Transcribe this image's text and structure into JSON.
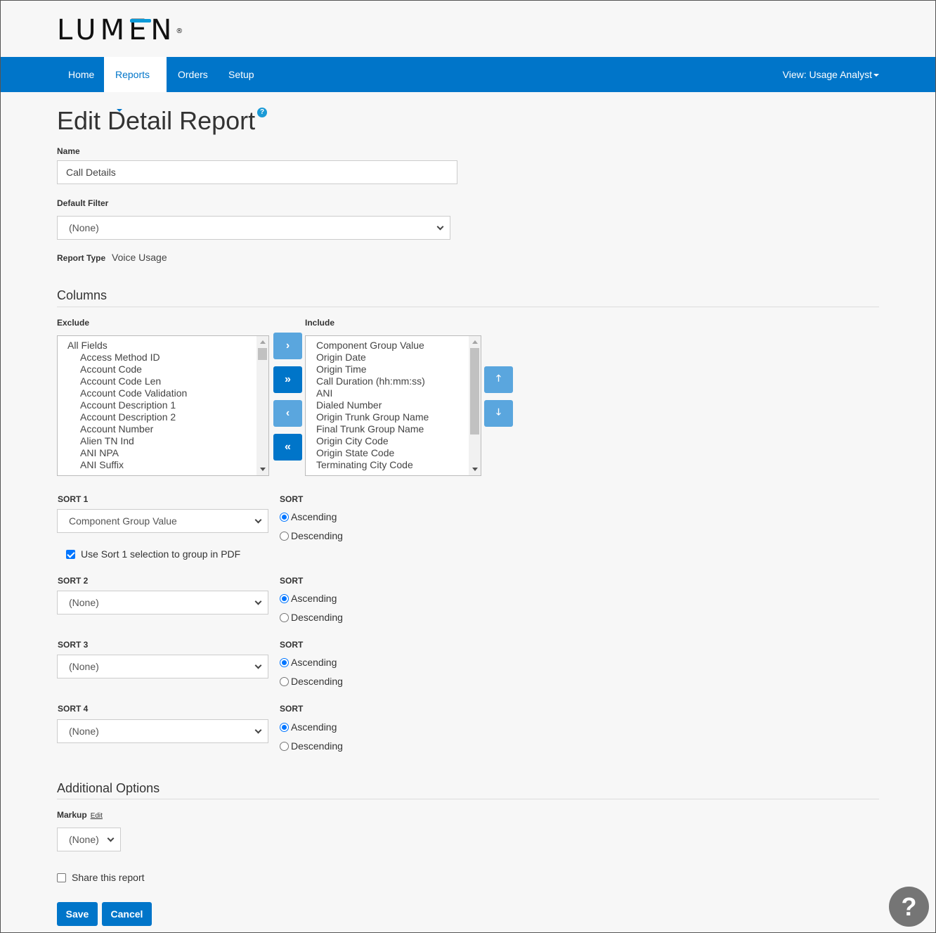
{
  "brand": {
    "logo_text_pre": "LUM",
    "logo_text_e": "E",
    "logo_text_post": "N",
    "registered": "®",
    "accent_color": "#0a9ad9"
  },
  "nav": {
    "items": [
      {
        "label": "Home"
      },
      {
        "label": "Reports",
        "active": true,
        "dropdown": true
      },
      {
        "label": "Orders"
      },
      {
        "label": "Setup"
      }
    ],
    "view_label": "View: Usage Analyst",
    "bar_color": "#0075c9"
  },
  "page": {
    "title": "Edit Detail Report",
    "help_icon": "?"
  },
  "form": {
    "name_label": "Name",
    "name_value": "Call Details",
    "default_filter_label": "Default Filter",
    "default_filter_value": "(None)",
    "report_type_label": "Report Type",
    "report_type_value": "Voice Usage"
  },
  "columns": {
    "heading": "Columns",
    "exclude_label": "Exclude",
    "include_label": "Include",
    "exclude_items": [
      {
        "label": "All Fields",
        "indent": false
      },
      {
        "label": "Access Method ID",
        "indent": true
      },
      {
        "label": "Account Code",
        "indent": true
      },
      {
        "label": "Account Code Len",
        "indent": true
      },
      {
        "label": "Account Code Validation",
        "indent": true
      },
      {
        "label": "Account Description 1",
        "indent": true
      },
      {
        "label": "Account Description 2",
        "indent": true
      },
      {
        "label": "Account Number",
        "indent": true
      },
      {
        "label": "Alien TN Ind",
        "indent": true
      },
      {
        "label": "ANI NPA",
        "indent": true
      },
      {
        "label": "ANI Suffix",
        "indent": true
      }
    ],
    "include_items": [
      "Component Group Value",
      "Origin Date",
      "Origin Time",
      "Call Duration (hh:mm:ss)",
      "ANI",
      "Dialed Number",
      "Origin Trunk Group Name",
      "Final Trunk Group Name",
      "Origin City Code",
      "Origin State Code",
      "Terminating City Code"
    ],
    "buttons": {
      "add": "›",
      "add_all": "»",
      "remove": "‹",
      "remove_all": "«",
      "move_up": "🡑",
      "move_down": "🡓"
    }
  },
  "sorts": [
    {
      "label": "SORT 1",
      "value": "Component Group Value",
      "order_label": "SORT",
      "ascending": "Ascending",
      "descending": "Descending",
      "selected": "Ascending"
    },
    {
      "label": "SORT 2",
      "value": "(None)",
      "order_label": "SORT",
      "ascending": "Ascending",
      "descending": "Descending",
      "selected": "Ascending"
    },
    {
      "label": "SORT 3",
      "value": "(None)",
      "order_label": "SORT",
      "ascending": "Ascending",
      "descending": "Descending",
      "selected": "Ascending"
    },
    {
      "label": "SORT 4",
      "value": "(None)",
      "order_label": "SORT",
      "ascending": "Ascending",
      "descending": "Descending",
      "selected": "Ascending"
    }
  ],
  "group_pdf": {
    "label": "Use Sort 1 selection to group in PDF",
    "checked": true
  },
  "additional": {
    "heading": "Additional Options",
    "markup_label": "Markup",
    "markup_edit": "Edit",
    "markup_value": "(None)",
    "share_label": "Share this report",
    "share_checked": false
  },
  "actions": {
    "save": "Save",
    "cancel": "Cancel"
  },
  "help_fab": "?"
}
